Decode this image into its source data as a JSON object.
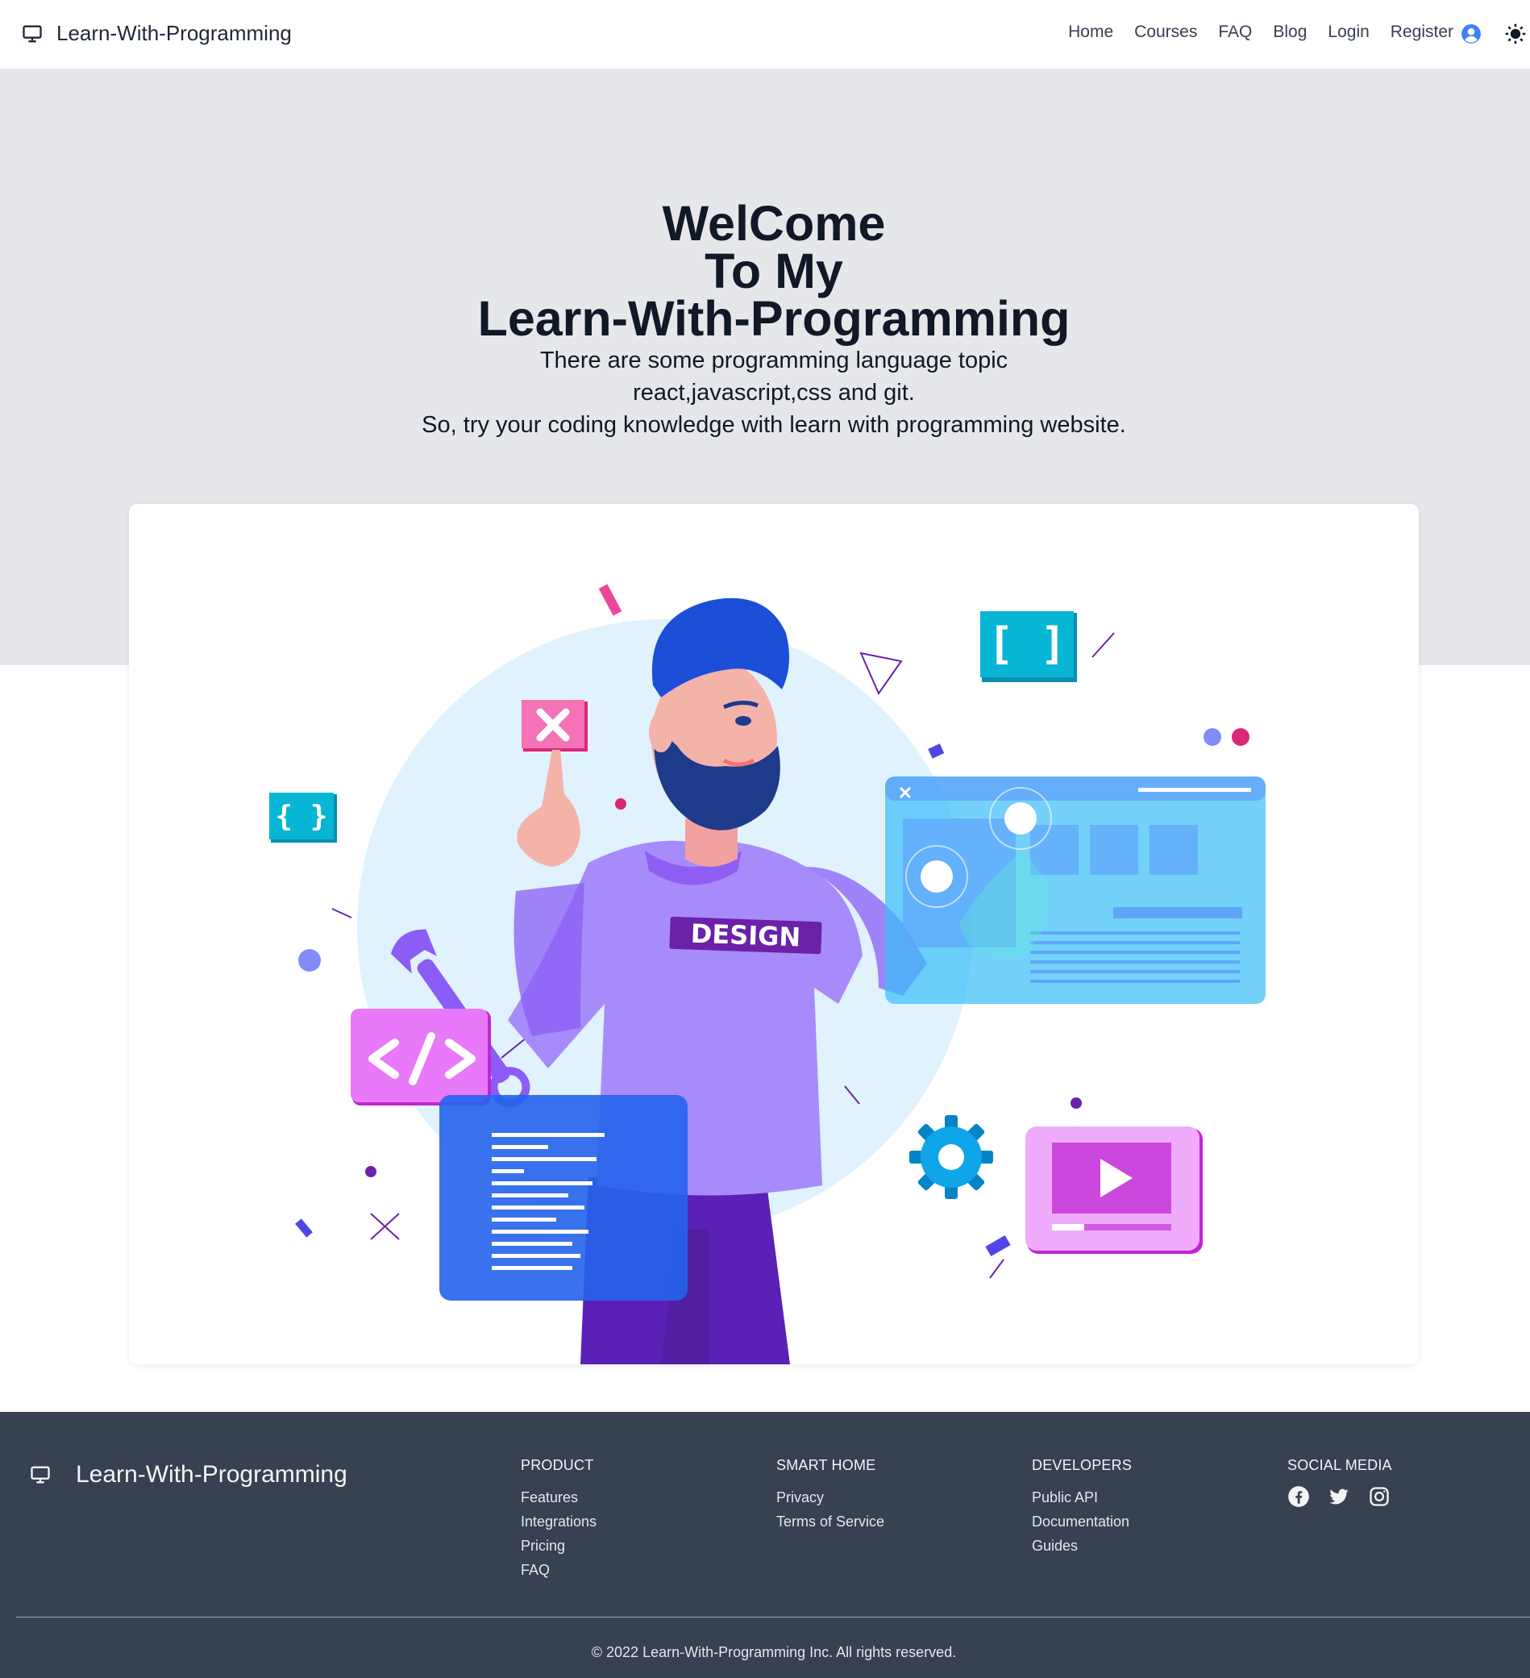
{
  "navbar": {
    "brand": "Learn-With-Programming",
    "links": [
      "Home",
      "Courses",
      "FAQ",
      "Blog",
      "Login",
      "Register"
    ]
  },
  "hero": {
    "title_line1": "WelCome",
    "title_line2": "To My",
    "title_line3": "Learn-With-Programming",
    "sub_line1": "There are some programming language topic",
    "sub_line2": "react,javascript,css and git.",
    "sub_line3": "So, try your coding knowledge with learn with programming website."
  },
  "illustration": {
    "shirt_text": "DESIGN"
  },
  "footer": {
    "brand": "Learn-With-Programming",
    "product": {
      "heading": "PRODUCT",
      "items": [
        "Features",
        "Integrations",
        "Pricing",
        "FAQ"
      ]
    },
    "smart_home": {
      "heading": "SMART HOME",
      "items": [
        "Privacy",
        "Terms of Service"
      ]
    },
    "developers": {
      "heading": "DEVELOPERS",
      "items": [
        "Public API",
        "Documentation",
        "Guides"
      ]
    },
    "social": {
      "heading": "SOCIAL MEDIA",
      "icons": [
        "facebook-icon",
        "twitter-icon",
        "instagram-icon"
      ]
    },
    "copyright": "© 2022 Learn-With-Programming Inc. All rights reserved."
  },
  "colors": {
    "hero_bg": "#e5e7eb",
    "footer_bg": "#374151",
    "accent_blue": "#3b82f6"
  }
}
